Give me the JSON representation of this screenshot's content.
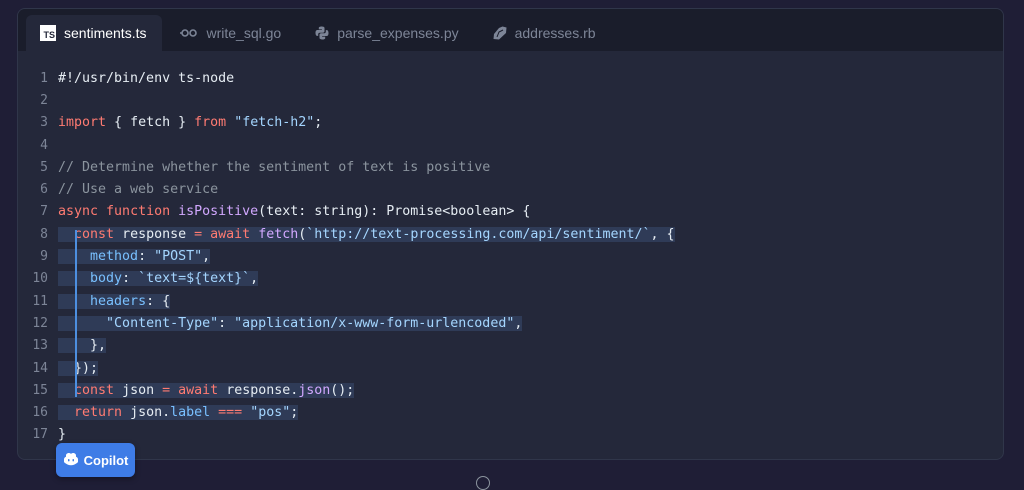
{
  "tabs": [
    {
      "label": "sentiments.ts",
      "icon": "typescript-icon",
      "badge": "TS",
      "active": true
    },
    {
      "label": "write_sql.go",
      "icon": "go-icon",
      "active": false
    },
    {
      "label": "parse_expenses.py",
      "icon": "python-icon",
      "active": false
    },
    {
      "label": "addresses.rb",
      "icon": "ruby-icon",
      "active": false
    }
  ],
  "code": {
    "line_numbers": [
      "1",
      "2",
      "3",
      "4",
      "5",
      "6",
      "7",
      "8",
      "9",
      "10",
      "11",
      "12",
      "13",
      "14",
      "15",
      "16",
      "17"
    ],
    "l1": "#!/usr/bin/env ts-node",
    "l3": {
      "import": "import",
      "open": " { ",
      "name": "fetch",
      "close": " } ",
      "from": "from",
      "space": " ",
      "module": "\"fetch-h2\"",
      "semi": ";"
    },
    "l5": "// Determine whether the sentiment of text is positive",
    "l6": "// Use a web service",
    "l7": {
      "async": "async",
      "function": "function",
      "fname": "isPositive",
      "params": "(text: string): Promise<boolean> {"
    },
    "l8": {
      "const": "const",
      "name": "response",
      "eq": "=",
      "await": "await",
      "fetch": "fetch",
      "url": "`http://text-processing.com/api/sentiment/`",
      "tail": ", {"
    },
    "l9": {
      "key": "method",
      "sep": ": ",
      "value": "\"POST\"",
      "tail": ","
    },
    "l10": {
      "key": "body",
      "sep": ": ",
      "value": "`text=${text}`",
      "tail": ","
    },
    "l11": {
      "key": "headers",
      "tail": ": {"
    },
    "l12": {
      "key": "\"Content-Type\"",
      "sep": ": ",
      "value": "\"application/x-www-form-urlencoded\"",
      "tail": ","
    },
    "l13": "},",
    "l14": "});",
    "l15": {
      "const": "const",
      "name": "json",
      "eq": "=",
      "await": "await",
      "obj": "response.",
      "method": "json",
      "tail": "();"
    },
    "l16": {
      "return": "return",
      "obj": "json.",
      "prop": "label",
      "op": "===",
      "value": "\"pos\"",
      "tail": ";"
    },
    "l17": "}"
  },
  "copilot": {
    "label": "Copilot",
    "icon": "copilot-icon"
  }
}
